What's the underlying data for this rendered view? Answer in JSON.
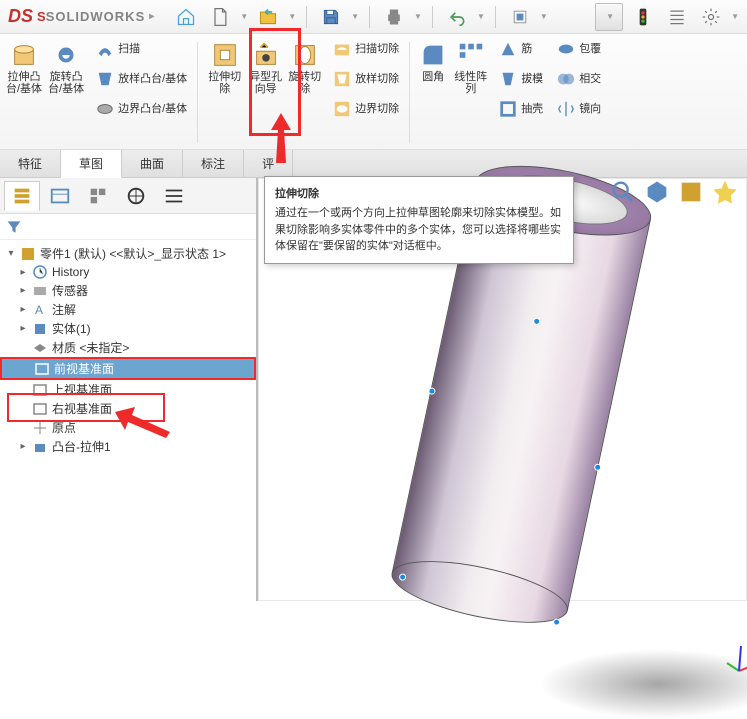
{
  "app": {
    "brand": "SOLIDWORKS",
    "prefix": "S"
  },
  "ribbon": {
    "extrude": "拉伸凸\n台/基体",
    "revolve": "旋转凸\n台/基体",
    "sweep": "扫描",
    "loft": "放样凸台/基体",
    "boundary": "边界凸台/基体",
    "extrude_cut": "拉伸切\n除",
    "hole": "异型孔\n向导",
    "revolve_cut": "旋转切\n除",
    "sweep_cut": "扫描切除",
    "loft_cut": "放样切除",
    "boundary_cut": "边界切除",
    "fillet": "圆角",
    "pattern": "线性阵\n列",
    "rib": "筋",
    "draft": "拔模",
    "shell": "抽壳",
    "wrap": "包覆",
    "intersect": "相交",
    "mirror": "镜向"
  },
  "tabs": {
    "feature": "特征",
    "sketch": "草图",
    "surface": "曲面",
    "markup": "标注",
    "evaluate": "评"
  },
  "tooltip": {
    "title": "拉伸切除",
    "body": "通过在一个或两个方向上拉伸草图轮廓来切除实体模型。如果切除影响多实体零件中的多个实体，您可以选择将哪些实体保留在\"要保留的实体\"对话框中。"
  },
  "tree": {
    "part": "零件1 (默认) <<默认>_显示状态 1>",
    "history": "History",
    "sensor": "传感器",
    "note": "注解",
    "body": "实体(1)",
    "material": "材质 <未指定>",
    "front": "前视基准面",
    "top": "上视基准面",
    "right": "右视基准面",
    "origin": "原点",
    "feat1": "凸台-拉伸1"
  }
}
